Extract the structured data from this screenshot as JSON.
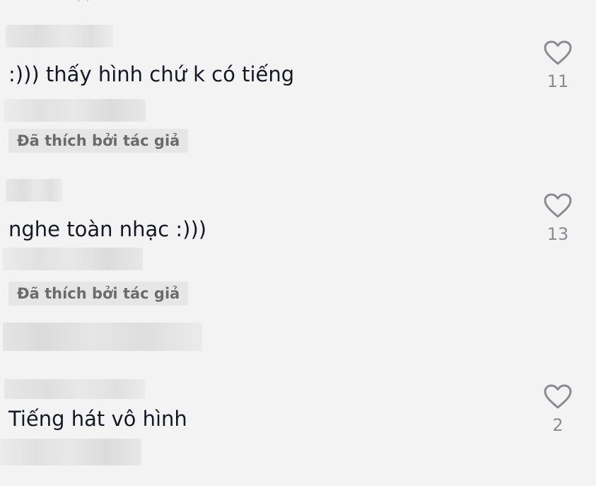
{
  "comments": [
    {
      "text": ":))) thấy hình chứ k có tiếng",
      "badge": "Đã thích bởi tác giả",
      "likes": "11"
    },
    {
      "text": "nghe toàn nhạc :)))",
      "badge": "Đã thích bởi tác giả",
      "likes": "13"
    },
    {
      "text": "Tiếng hát vô hình",
      "badge": "",
      "likes": "2"
    }
  ],
  "icons": {
    "like": "heart-outline-icon"
  },
  "colors": {
    "background": "#f3f3f3",
    "text": "#161823",
    "count": "#8a8b91",
    "badge_bg": "#e6e6e6",
    "badge_text": "#6b6b6b"
  }
}
